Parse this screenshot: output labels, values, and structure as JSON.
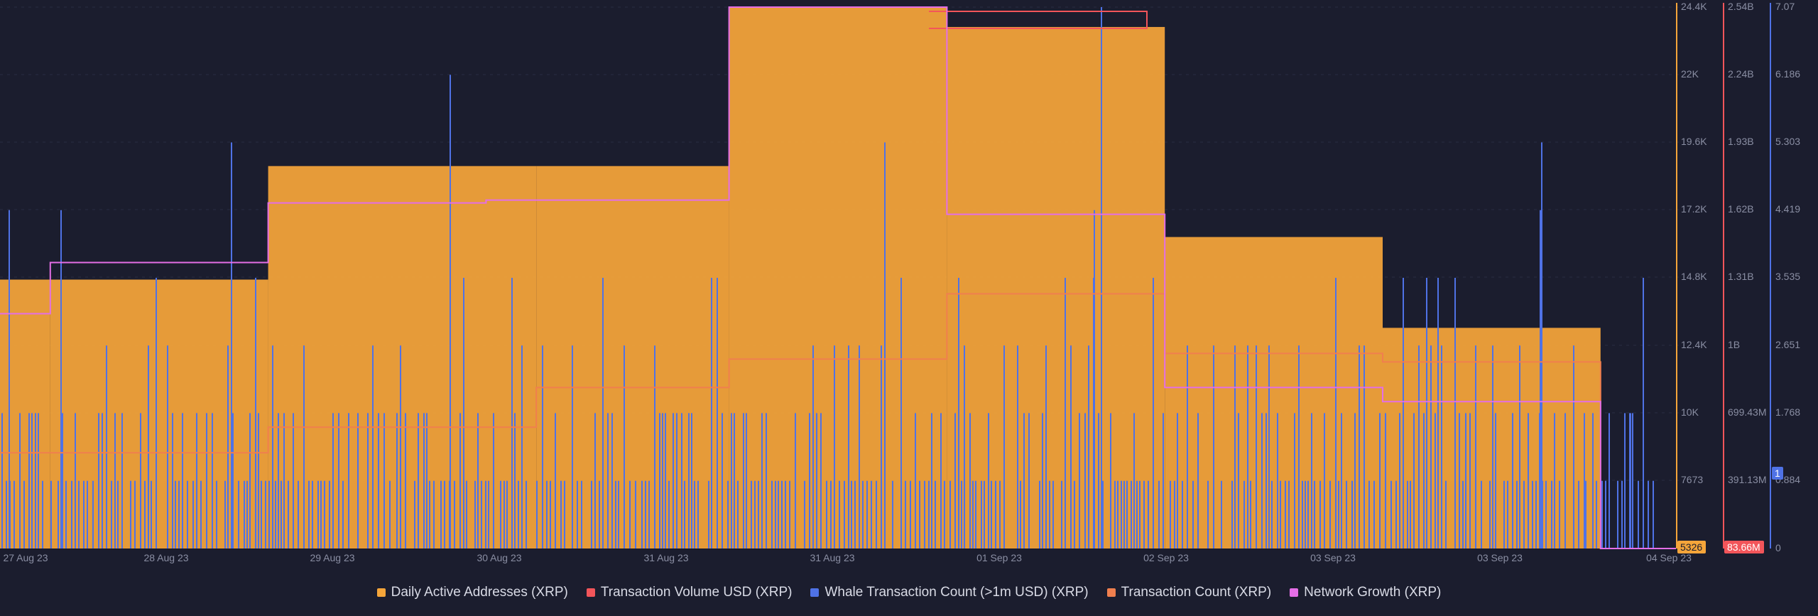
{
  "chart_data": {
    "type": "bar",
    "x_labels": [
      "27 Aug 23",
      "28 Aug 23",
      "29 Aug 23",
      "30 Aug 23",
      "31 Aug 23",
      "31 Aug 23",
      "01 Sep 23",
      "02 Sep 23",
      "03 Sep 23",
      "03 Sep 23",
      "04 Sep 23"
    ],
    "axes": {
      "daa": {
        "ticks": [
          "24.4K",
          "22K",
          "19.6K",
          "17.2K",
          "14.8K",
          "12.4K",
          "10K",
          "7673"
        ],
        "min": 5326,
        "max": 24400,
        "current_label": "5326",
        "color": "#f5a53a"
      },
      "volume": {
        "ticks": [
          "2.54B",
          "2.24B",
          "1.93B",
          "1.62B",
          "1.31B",
          "1B",
          "699.43M",
          "391.13M"
        ],
        "min": 83660000,
        "max": 2540000000,
        "current_label": "83.66M",
        "color": "#f2555a"
      },
      "whale": {
        "ticks": [
          "7.07",
          "6.186",
          "5.303",
          "4.419",
          "3.535",
          "2.651",
          "1.768",
          "0.884",
          "0"
        ],
        "min": 0,
        "max": 7.07,
        "current_label": "1",
        "color": "#4f72e6"
      }
    },
    "series": [
      {
        "name": "Daily Active Addresses (XRP)",
        "color": "#f5a53a",
        "axis": "daa",
        "values": [
          [
            0,
            14800
          ],
          [
            0.3,
            14800
          ],
          [
            1.6,
            18800
          ],
          [
            3.2,
            18800
          ],
          [
            4.35,
            24400
          ],
          [
            5.65,
            23700
          ],
          [
            6.95,
            16300
          ],
          [
            8.25,
            13100
          ],
          [
            9.55,
            5326
          ],
          [
            10,
            5326
          ]
        ]
      },
      {
        "name": "Transaction Volume USD (XRP)",
        "color": "#f2555a",
        "axis": "volume",
        "values": []
      },
      {
        "name": "Whale Transaction Count (>1m USD) (XRP)",
        "color": "#4f72e6",
        "axis": "whale",
        "values": []
      },
      {
        "name": "Transaction Count (XRP)",
        "color": "#f07f4e",
        "axis": "daa",
        "values": [
          [
            0,
            8700
          ],
          [
            0.3,
            8700
          ],
          [
            1.6,
            9600
          ],
          [
            2.9,
            9600
          ],
          [
            3.2,
            11000
          ],
          [
            4.35,
            12000
          ],
          [
            5.65,
            14300
          ],
          [
            6.95,
            12200
          ],
          [
            8.25,
            11900
          ],
          [
            9.55,
            5326
          ]
        ]
      },
      {
        "name": "Network Growth (XRP)",
        "color": "#e46ee6",
        "axis": "daa",
        "values": [
          [
            0,
            13600
          ],
          [
            0.3,
            15400
          ],
          [
            1.6,
            17500
          ],
          [
            2.9,
            17600
          ],
          [
            4.35,
            24400
          ],
          [
            5.65,
            17100
          ],
          [
            6.95,
            11000
          ],
          [
            8.25,
            10500
          ],
          [
            9.55,
            5326
          ]
        ]
      }
    ]
  },
  "legend": [
    {
      "label": "Daily Active Addresses (XRP)",
      "color": "#f5a53a"
    },
    {
      "label": "Transaction Volume USD (XRP)",
      "color": "#f2555a"
    },
    {
      "label": "Whale Transaction Count (>1m USD) (XRP)",
      "color": "#4f72e6"
    },
    {
      "label": "Transaction Count (XRP)",
      "color": "#f07f4e"
    },
    {
      "label": "Network Growth (XRP)",
      "color": "#e46ee6"
    }
  ]
}
